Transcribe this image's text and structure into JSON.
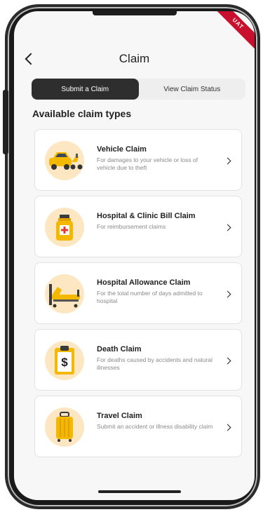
{
  "badge": {
    "label": "UAT",
    "color": "#c8102e"
  },
  "header": {
    "title": "Claim",
    "back_icon": "chevron-left-icon"
  },
  "tabs": [
    {
      "label": "Submit a Claim",
      "active": true
    },
    {
      "label": "View Claim Status",
      "active": false
    }
  ],
  "section_title": "Available claim types",
  "claims": [
    {
      "title": "Vehicle Claim",
      "description": "For damages to your vehicle or loss of vehicle due to theft",
      "icon": "car-scooter-icon"
    },
    {
      "title": "Hospital & Clinic Bill Claim",
      "description": "For reimbursement claims",
      "icon": "medicine-bottle-icon"
    },
    {
      "title": "Hospital Allowance Claim",
      "description": "For the total number of days admitted to hospital",
      "icon": "hospital-bed-icon"
    },
    {
      "title": "Death Claim",
      "description": "For deaths caused by accidents and natural illnesses",
      "icon": "clipboard-dollar-icon"
    },
    {
      "title": "Travel Claim",
      "description": "Submit an accident or illness disability claim",
      "icon": "suitcase-icon"
    }
  ],
  "colors": {
    "active_tab": "#2e2e2e",
    "icon_bg": "#fde7c2",
    "accent_yellow": "#f5b800"
  }
}
